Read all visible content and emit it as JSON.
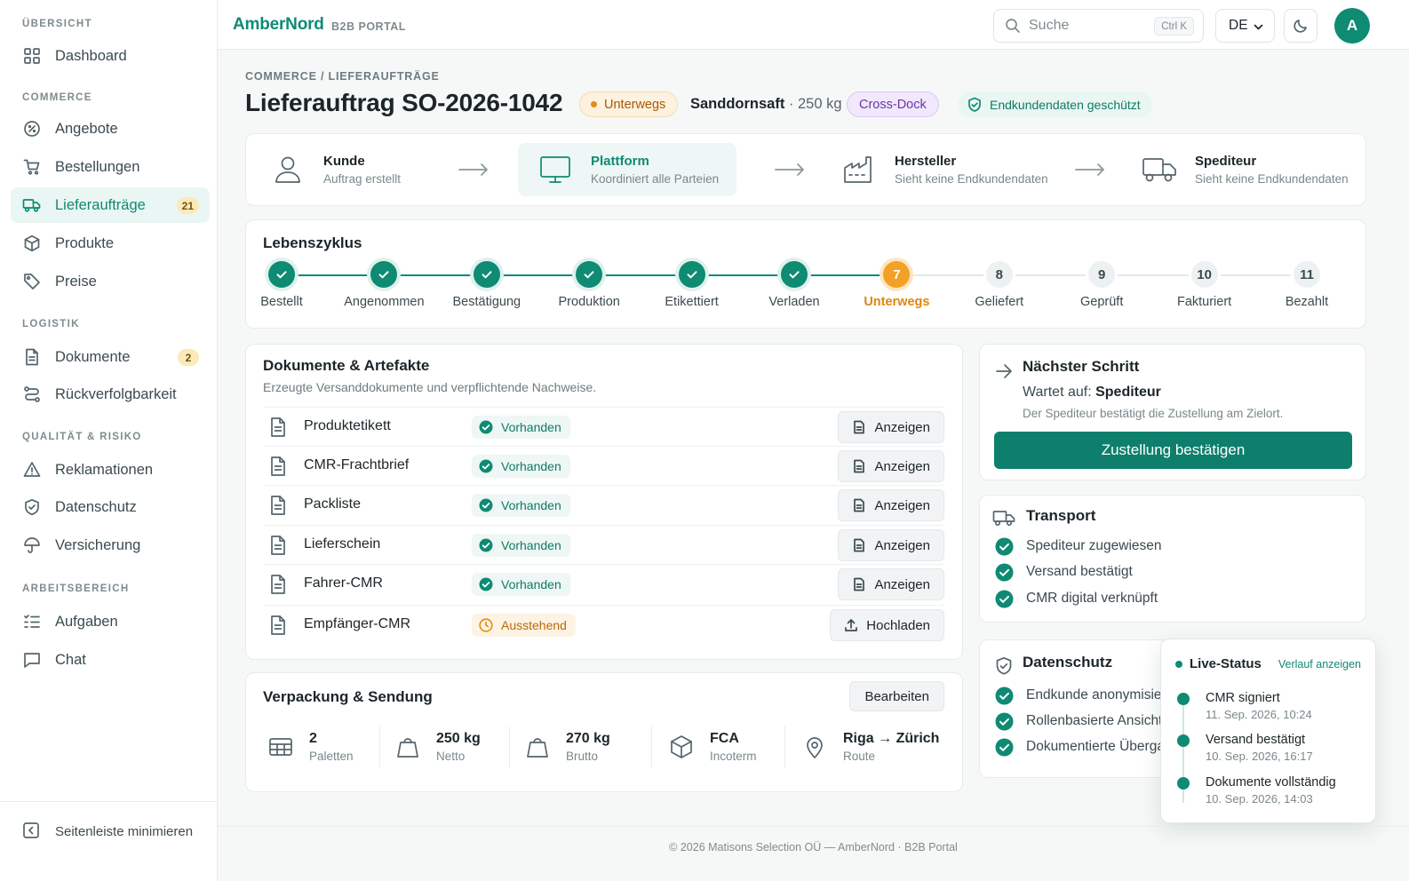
{
  "sidebar": {
    "sections": [
      {
        "label": "ÜBERSICHT",
        "items": [
          {
            "label": "Dashboard",
            "icon": "grid-icon"
          }
        ]
      },
      {
        "label": "COMMERCE",
        "items": [
          {
            "label": "Angebote",
            "icon": "tag-percent-icon"
          },
          {
            "label": "Bestellungen",
            "icon": "cart-icon"
          },
          {
            "label": "Lieferaufträge",
            "icon": "truck-icon",
            "badge": "21",
            "active": true
          },
          {
            "label": "Produkte",
            "icon": "box-icon"
          },
          {
            "label": "Preise",
            "icon": "price-tag-icon"
          }
        ]
      },
      {
        "label": "LOGISTIK",
        "items": [
          {
            "label": "Dokumente",
            "icon": "document-icon",
            "badge": "2"
          },
          {
            "label": "Rückverfolgbarkeit",
            "icon": "route-icon"
          }
        ]
      },
      {
        "label": "QUALITÄT & RISIKO",
        "items": [
          {
            "label": "Reklamationen",
            "icon": "warning-icon"
          },
          {
            "label": "Datenschutz",
            "icon": "shield-icon"
          },
          {
            "label": "Versicherung",
            "icon": "umbrella-icon"
          }
        ]
      },
      {
        "label": "ARBEITSBEREICH",
        "items": [
          {
            "label": "Aufgaben",
            "icon": "checklist-icon"
          },
          {
            "label": "Chat",
            "icon": "chat-icon"
          }
        ]
      }
    ],
    "minimize_label": "Seitenleiste minimieren"
  },
  "header": {
    "brand": "AmberNord",
    "brand_sub": "B2B PORTAL",
    "search_placeholder": "Suche",
    "search_shortcut": "Ctrl K",
    "language": "DE",
    "avatar_initial": "A"
  },
  "page": {
    "breadcrumb": "COMMERCE / LIEFERAUFTRÄGE",
    "title": "Lieferauftrag SO-2026-1042",
    "status": "Unterwegs",
    "product_name": "Sanddornsaft",
    "product_weight": " · 250 kg",
    "mode": "Cross-Dock",
    "privacy": "Endkundendaten geschützt"
  },
  "flow": [
    {
      "title": "Kunde",
      "subtitle": "Auftrag erstellt",
      "icon": "user-icon"
    },
    {
      "title": "Plattform",
      "subtitle": "Koordiniert alle Parteien",
      "icon": "monitor-icon",
      "highlight": true
    },
    {
      "title": "Hersteller",
      "subtitle": "Sieht keine Endkundendaten",
      "icon": "factory-icon"
    },
    {
      "title": "Spediteur",
      "subtitle": "Sieht keine Endkundendaten",
      "icon": "truck-icon"
    }
  ],
  "lifecycle": {
    "title": "Lebenszyklus",
    "steps": [
      {
        "label": "Bestellt",
        "state": "done",
        "num": "1"
      },
      {
        "label": "Angenommen",
        "state": "done",
        "num": "2"
      },
      {
        "label": "Bestätigung",
        "state": "done",
        "num": "3"
      },
      {
        "label": "Produktion",
        "state": "done",
        "num": "4"
      },
      {
        "label": "Etikettiert",
        "state": "done",
        "num": "5"
      },
      {
        "label": "Verladen",
        "state": "done",
        "num": "6"
      },
      {
        "label": "Unterwegs",
        "state": "current",
        "num": "7"
      },
      {
        "label": "Geliefert",
        "state": "todo",
        "num": "8"
      },
      {
        "label": "Geprüft",
        "state": "todo",
        "num": "9"
      },
      {
        "label": "Fakturiert",
        "state": "todo",
        "num": "10"
      },
      {
        "label": "Bezahlt",
        "state": "todo",
        "num": "11"
      }
    ]
  },
  "documents": {
    "title": "Dokumente & Artefakte",
    "subtitle": "Erzeugte Versanddokumente und verpflichtende Nachweise.",
    "rows": [
      {
        "name": "Produktetikett",
        "status": "Vorhanden",
        "action": "Anzeigen"
      },
      {
        "name": "CMR-Frachtbrief",
        "status": "Vorhanden",
        "action": "Anzeigen"
      },
      {
        "name": "Packliste",
        "status": "Vorhanden",
        "action": "Anzeigen"
      },
      {
        "name": "Lieferschein",
        "status": "Vorhanden",
        "action": "Anzeigen"
      },
      {
        "name": "Fahrer-CMR",
        "status": "Vorhanden",
        "action": "Anzeigen"
      },
      {
        "name": "Empfänger-CMR",
        "status": "Ausstehend",
        "action": "Hochladen"
      }
    ]
  },
  "packaging": {
    "title": "Verpackung & Sendung",
    "edit_label": "Bearbeiten",
    "items": [
      {
        "value": "2",
        "label": "Paletten",
        "icon": "pallet-icon"
      },
      {
        "value": "250 kg",
        "label": "Netto",
        "icon": "weight-icon"
      },
      {
        "value": "270 kg",
        "label": "Brutto",
        "icon": "weight-icon"
      },
      {
        "value": "FCA",
        "label": "Incoterm",
        "icon": "cube-icon"
      },
      {
        "value": "Riga → Zürich",
        "label": "Route",
        "icon": "location-pin-icon"
      }
    ]
  },
  "next_step": {
    "title": "Nächster Schritt",
    "waiting_label": "Wartet auf: ",
    "waiting_party": "Spediteur",
    "description": "Der Spediteur bestätigt die Zustellung am Zielort.",
    "button": "Zustellung bestätigen"
  },
  "transport": {
    "title": "Transport",
    "items": [
      "Spediteur zugewiesen",
      "Versand bestätigt",
      "CMR digital verknüpft"
    ]
  },
  "privacy_card": {
    "title": "Datenschutz",
    "items": [
      "Endkunde anonymisiert",
      "Rollenbasierte Ansicht",
      "Dokumentierte Übergabe"
    ]
  },
  "live_status": {
    "title": "Live-Status",
    "link": "Verlauf anzeigen",
    "events": [
      {
        "title": "CMR signiert",
        "time": "11. Sep. 2026, 10:24"
      },
      {
        "title": "Versand bestätigt",
        "time": "10. Sep. 2026, 16:17"
      },
      {
        "title": "Dokumente vollständig",
        "time": "10. Sep. 2026, 14:03"
      }
    ]
  },
  "footer": "© 2026 Matisons Selection OÜ — AmberNord · B2B Portal",
  "colors": {
    "accent": "#0f8a73",
    "warning": "#f2a126",
    "purple": "#6a35a8"
  }
}
